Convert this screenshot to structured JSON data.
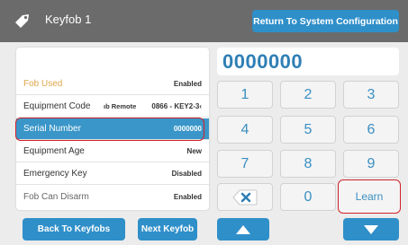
{
  "header": {
    "title": "Keyfob 1",
    "return_label": "Return To System Configuration"
  },
  "rows": [
    {
      "label": "Fob Used",
      "value": "Enabled"
    },
    {
      "label": "Equipment Code",
      "sub": "ıb Remote",
      "value": "0866 - KEY2-3‹"
    },
    {
      "label": "Serial Number",
      "value": "0000000"
    },
    {
      "label": "Equipment Age",
      "value": "New"
    },
    {
      "label": "Emergency Key",
      "value": "Disabled"
    },
    {
      "label": "Fob Can Disarm",
      "value": "Enabled"
    }
  ],
  "display": {
    "value": "0000000"
  },
  "keypad": {
    "k1": "1",
    "k2": "2",
    "k3": "3",
    "k4": "4",
    "k5": "5",
    "k6": "6",
    "k7": "7",
    "k8": "8",
    "k9": "9",
    "k0": "0",
    "clear_icon": "backspace-clear-icon",
    "learn": "Learn"
  },
  "footer": {
    "back_label": "Back To Keyfobs",
    "next_label": "Next Keyfob",
    "up_icon": "arrow-up-icon",
    "down_icon": "arrow-down-icon"
  },
  "colors": {
    "accent": "#2f8fc9",
    "selected_row": "#3a96c8",
    "highlight": "#d0232a",
    "header": "#6b6b6b"
  }
}
